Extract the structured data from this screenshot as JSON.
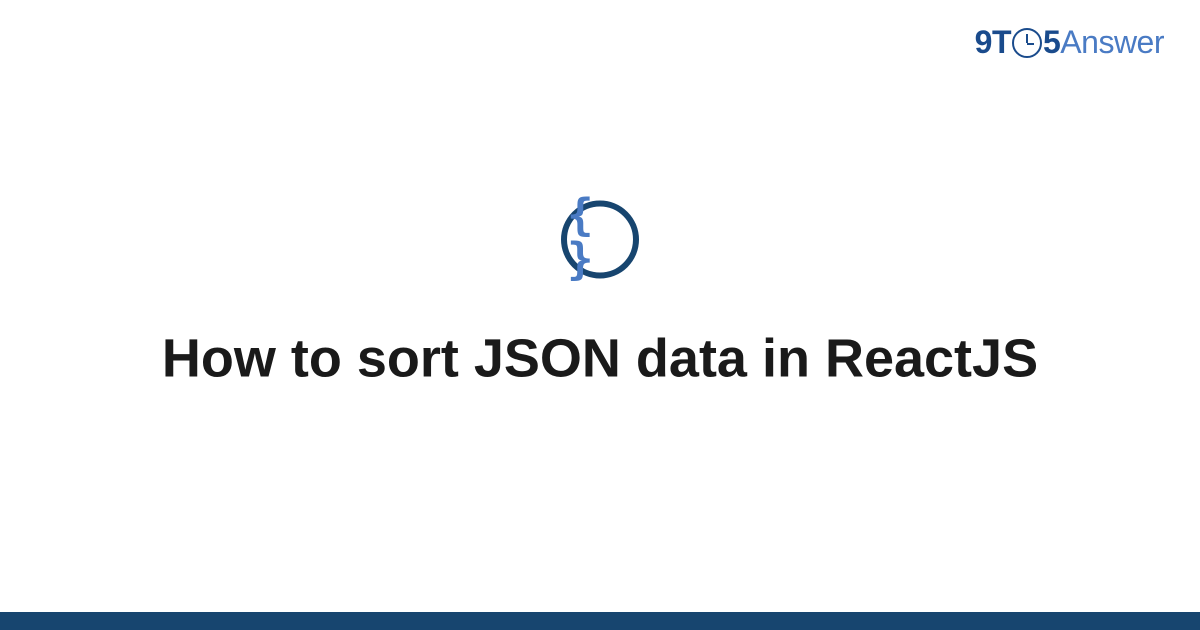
{
  "brand": {
    "prefix_nine": "9",
    "prefix_t": "T",
    "prefix_five": "5",
    "suffix": "Answer"
  },
  "topic": {
    "icon_glyph": "{ }",
    "icon_name": "json-braces"
  },
  "question": {
    "title": "How to sort JSON data in ReactJS"
  },
  "colors": {
    "brand_dark": "#1a4b8c",
    "brand_light": "#4a7bc4",
    "icon_border": "#17456f",
    "footer_bar": "#17456f"
  }
}
